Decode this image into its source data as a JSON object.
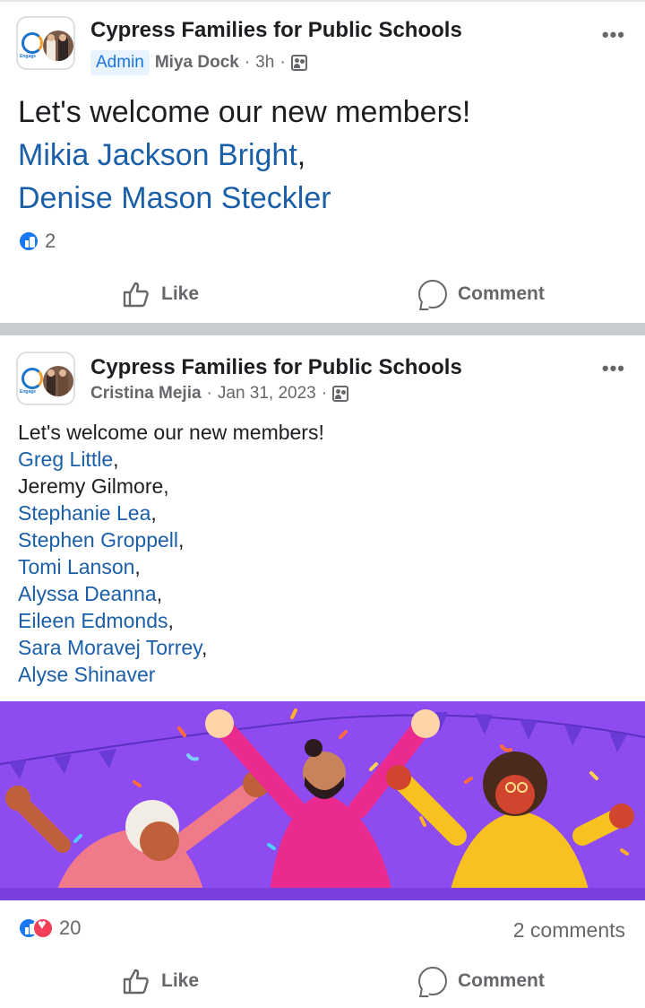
{
  "posts": [
    {
      "group_name": "Cypress Families for Public Schools",
      "badge": "Admin",
      "author": "Miya Dock",
      "time": "3h",
      "separator": "·",
      "text_lines": [
        {
          "text": "Let's welcome our new members!",
          "kind": "plain"
        },
        {
          "text": "Mikia Jackson Bright",
          "suffix": ",",
          "kind": "link"
        },
        {
          "text": "Denise Mason Steckler",
          "suffix": "",
          "kind": "link"
        }
      ],
      "reaction_count": "2",
      "actions": {
        "like": "Like",
        "comment": "Comment"
      }
    },
    {
      "group_name": "Cypress Families for Public Schools",
      "author": "Cristina Mejia",
      "time": "Jan 31, 2023",
      "separator": "·",
      "text_lines": [
        {
          "text": "Let's welcome our new members!",
          "kind": "plain"
        },
        {
          "text": "Greg Little",
          "suffix": ",",
          "kind": "link"
        },
        {
          "text": "Jeremy Gilmore,",
          "suffix": "",
          "kind": "plain"
        },
        {
          "text": "Stephanie Lea",
          "suffix": ",",
          "kind": "link"
        },
        {
          "text": "Stephen Groppell",
          "suffix": ",",
          "kind": "link"
        },
        {
          "text": "Tomi Lanson",
          "suffix": ",",
          "kind": "link"
        },
        {
          "text": "Alyssa Deanna",
          "suffix": ",",
          "kind": "link"
        },
        {
          "text": "Eileen Edmonds",
          "suffix": ",",
          "kind": "link"
        },
        {
          "text": "Sara Moravej Torrey",
          "suffix": ",",
          "kind": "link"
        },
        {
          "text": "Alyse Shinaver",
          "suffix": "",
          "kind": "link"
        }
      ],
      "reaction_count": "20",
      "comments_count": "2 comments",
      "actions": {
        "like": "Like",
        "comment": "Comment"
      }
    }
  ],
  "more_icon": "•••",
  "logo_tag": "Engage",
  "colors": {
    "link": "#1b5fa8",
    "like_blue": "#1877f2",
    "love_red": "#f33e58",
    "banner_purple": "#8e4cf0",
    "admin_bg": "#e7f3ff"
  },
  "icons": [
    "more-horizontal-icon",
    "audience-group-icon",
    "like-reaction-icon",
    "love-reaction-icon",
    "thumb-up-icon",
    "comment-bubble-icon"
  ]
}
